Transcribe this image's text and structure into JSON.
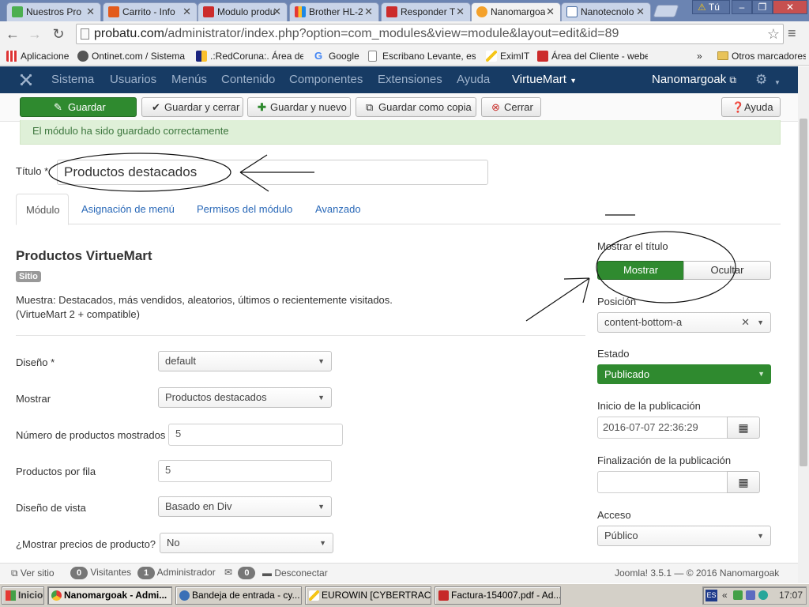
{
  "browser": {
    "tabs": [
      {
        "label": "Nuestros Pro",
        "color": "#4caf50"
      },
      {
        "label": "Carrito - Info",
        "color": "#e35b1c"
      },
      {
        "label": "Modulo produ",
        "color": "#cc2b2b"
      },
      {
        "label": "Brother HL-2",
        "color": "#3a4fb0"
      },
      {
        "label": "Responder T",
        "color": "#cc2b2b"
      },
      {
        "label": "Nanomargoa",
        "color": "#1d5aa0"
      },
      {
        "label": "Nanotecnolo",
        "color": "#4a6fa5"
      }
    ],
    "profile_label": "Tú",
    "url_host": "probatu.com",
    "url_path": "/administrator/index.php?option=com_modules&view=module&layout=edit&id=89",
    "bookmarks": [
      {
        "label": "Aplicaciones",
        "icon": "apps-icon"
      },
      {
        "label": "Ontinet.com / Sistema d",
        "icon": "ontinet-icon"
      },
      {
        "label": ".:RedCoruna:. Área de",
        "icon": "redcoruna-icon"
      },
      {
        "label": "Google",
        "icon": "google-icon"
      },
      {
        "label": "Escribano Levante, esp",
        "icon": "page-icon"
      },
      {
        "label": "EximIT",
        "icon": "eximit-icon"
      },
      {
        "label": "Área del Cliente - weber",
        "icon": "weber-icon"
      }
    ],
    "other_bookmarks": "Otros marcadores"
  },
  "joomla": {
    "menu": [
      "Sistema",
      "Usuarios",
      "Menús",
      "Contenido",
      "Componentes",
      "Extensiones",
      "Ayuda",
      "VirtueMart"
    ],
    "site_link": "Nanomargoak",
    "toolbar": {
      "save": "Guardar",
      "save_close": "Guardar y cerrar",
      "save_new": "Guardar y nuevo",
      "save_copy": "Guardar como copia",
      "close": "Cerrar",
      "help": "Ayuda"
    },
    "alert": "El módulo ha sido guardado correctamente",
    "title_label": "Título *",
    "title_value": "Productos destacados",
    "tabs": [
      "Módulo",
      "Asignación de menú",
      "Permisos del módulo",
      "Avanzado"
    ],
    "module": {
      "heading": "Productos VirtueMart",
      "badge": "Sitio",
      "desc1": "Muestra: Destacados, más vendidos, aleatorios, últimos o recientemente visitados.",
      "desc2": "(VirtueMart 2 + compatible)"
    },
    "fields": {
      "layout_label": "Diseño *",
      "layout_value": "default",
      "show_label": "Mostrar",
      "show_value": "Productos destacados",
      "num_label": "Número de productos mostrados",
      "num_value": "5",
      "perrow_label": "Productos por fila",
      "perrow_value": "5",
      "view_label": "Diseño de vista",
      "view_value": "Basado en Div",
      "prices_label": "¿Mostrar precios de producto?",
      "prices_value": "No"
    },
    "side": {
      "show_title_label": "Mostrar el título",
      "show": "Mostrar",
      "hide": "Ocultar",
      "position_label": "Posición",
      "position_value": "content-bottom-a",
      "status_label": "Estado",
      "status_value": "Publicado",
      "publish_up_label": "Inicio de la publicación",
      "publish_up_value": "2016-07-07 22:36:29",
      "publish_down_label": "Finalización de la publicación",
      "publish_down_value": "",
      "access_label": "Acceso",
      "access_value": "Público"
    },
    "status": {
      "view_site": "Ver sitio",
      "visitors_count": "0",
      "visitors_label": "Visitantes",
      "admin_count": "1",
      "admin_label": "Administrador",
      "messages_count": "0",
      "logout": "Desconectar",
      "version": "Joomla! 3.5.1 — © 2016 Nanomargoak"
    },
    "colors": {
      "nav": "#173b64",
      "primary": "#2f8a2f",
      "link": "#2a69b8"
    }
  },
  "taskbar": {
    "start": "Inicio",
    "items": [
      {
        "label": "Nanomargoak - Admi...",
        "active": true
      },
      {
        "label": "Bandeja de entrada - cy...",
        "active": false
      },
      {
        "label": "EUROWIN  [CYBERTRAC...",
        "active": false
      },
      {
        "label": "Factura-154007.pdf - Ad...",
        "active": false
      }
    ],
    "clock": "17:07",
    "lang": "ES"
  }
}
